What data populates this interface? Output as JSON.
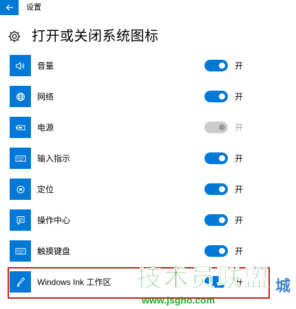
{
  "titlebar": {
    "title": "设置",
    "back_icon": "back-arrow-icon"
  },
  "header": {
    "icon": "gear-icon",
    "title": "打开或关闭系统图标"
  },
  "accent_color": "#0078d7",
  "items": [
    {
      "label": "音量",
      "icon": "volume-icon",
      "state": "开",
      "on": true,
      "enabled": true
    },
    {
      "label": "网络",
      "icon": "globe-icon",
      "state": "开",
      "on": true,
      "enabled": true
    },
    {
      "label": "电源",
      "icon": "battery-icon",
      "state": "开",
      "on": true,
      "enabled": false
    },
    {
      "label": "输入指示",
      "icon": "keyboard-icon",
      "state": "开",
      "on": true,
      "enabled": true
    },
    {
      "label": "定位",
      "icon": "location-icon",
      "state": "开",
      "on": true,
      "enabled": true
    },
    {
      "label": "操作中心",
      "icon": "action-center-icon",
      "state": "开",
      "on": true,
      "enabled": true
    },
    {
      "label": "触摸键盘",
      "icon": "keyboard-icon",
      "state": "开",
      "on": true,
      "enabled": true
    },
    {
      "label": "Windows Ink 工作区",
      "icon": "pen-icon",
      "state": "开",
      "on": true,
      "enabled": true
    }
  ],
  "watermark": {
    "main": "技术员联盟",
    "url": "www.jsgho.com",
    "side": "城"
  }
}
